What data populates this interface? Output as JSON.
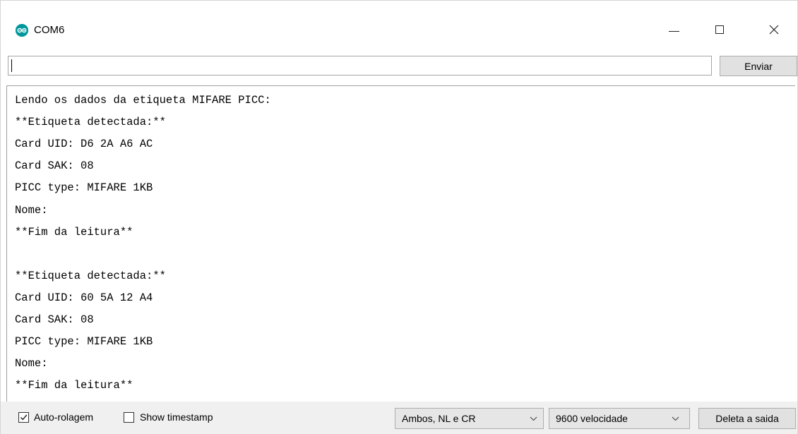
{
  "window": {
    "title": "COM6",
    "icon": "arduino-icon",
    "controls": {
      "minimize": "minimize-icon",
      "maximize": "maximize-icon",
      "close": "close-icon"
    }
  },
  "send": {
    "input_value": "",
    "button_label": "Enviar"
  },
  "output": {
    "lines": [
      "Lendo os dados da etiqueta MIFARE PICC:",
      "**Etiqueta detectada:**",
      "Card UID: D6 2A A6 AC",
      "Card SAK: 08",
      "PICC type: MIFARE 1KB",
      "Nome:",
      "**Fim da leitura**",
      "",
      "**Etiqueta detectada:**",
      "Card UID: 60 5A 12 A4",
      "Card SAK: 08",
      "PICC type: MIFARE 1KB",
      "Nome:",
      "**Fim da leitura**"
    ]
  },
  "footer": {
    "autoscroll": {
      "label": "Auto-rolagem",
      "checked": true
    },
    "timestamp": {
      "label": "Show timestamp",
      "checked": false
    },
    "line_ending": "Ambos, NL e CR",
    "baud_rate": "9600 velocidade",
    "clear_label": "Deleta a saida"
  },
  "colors": {
    "arduino_teal": "#00979c"
  }
}
